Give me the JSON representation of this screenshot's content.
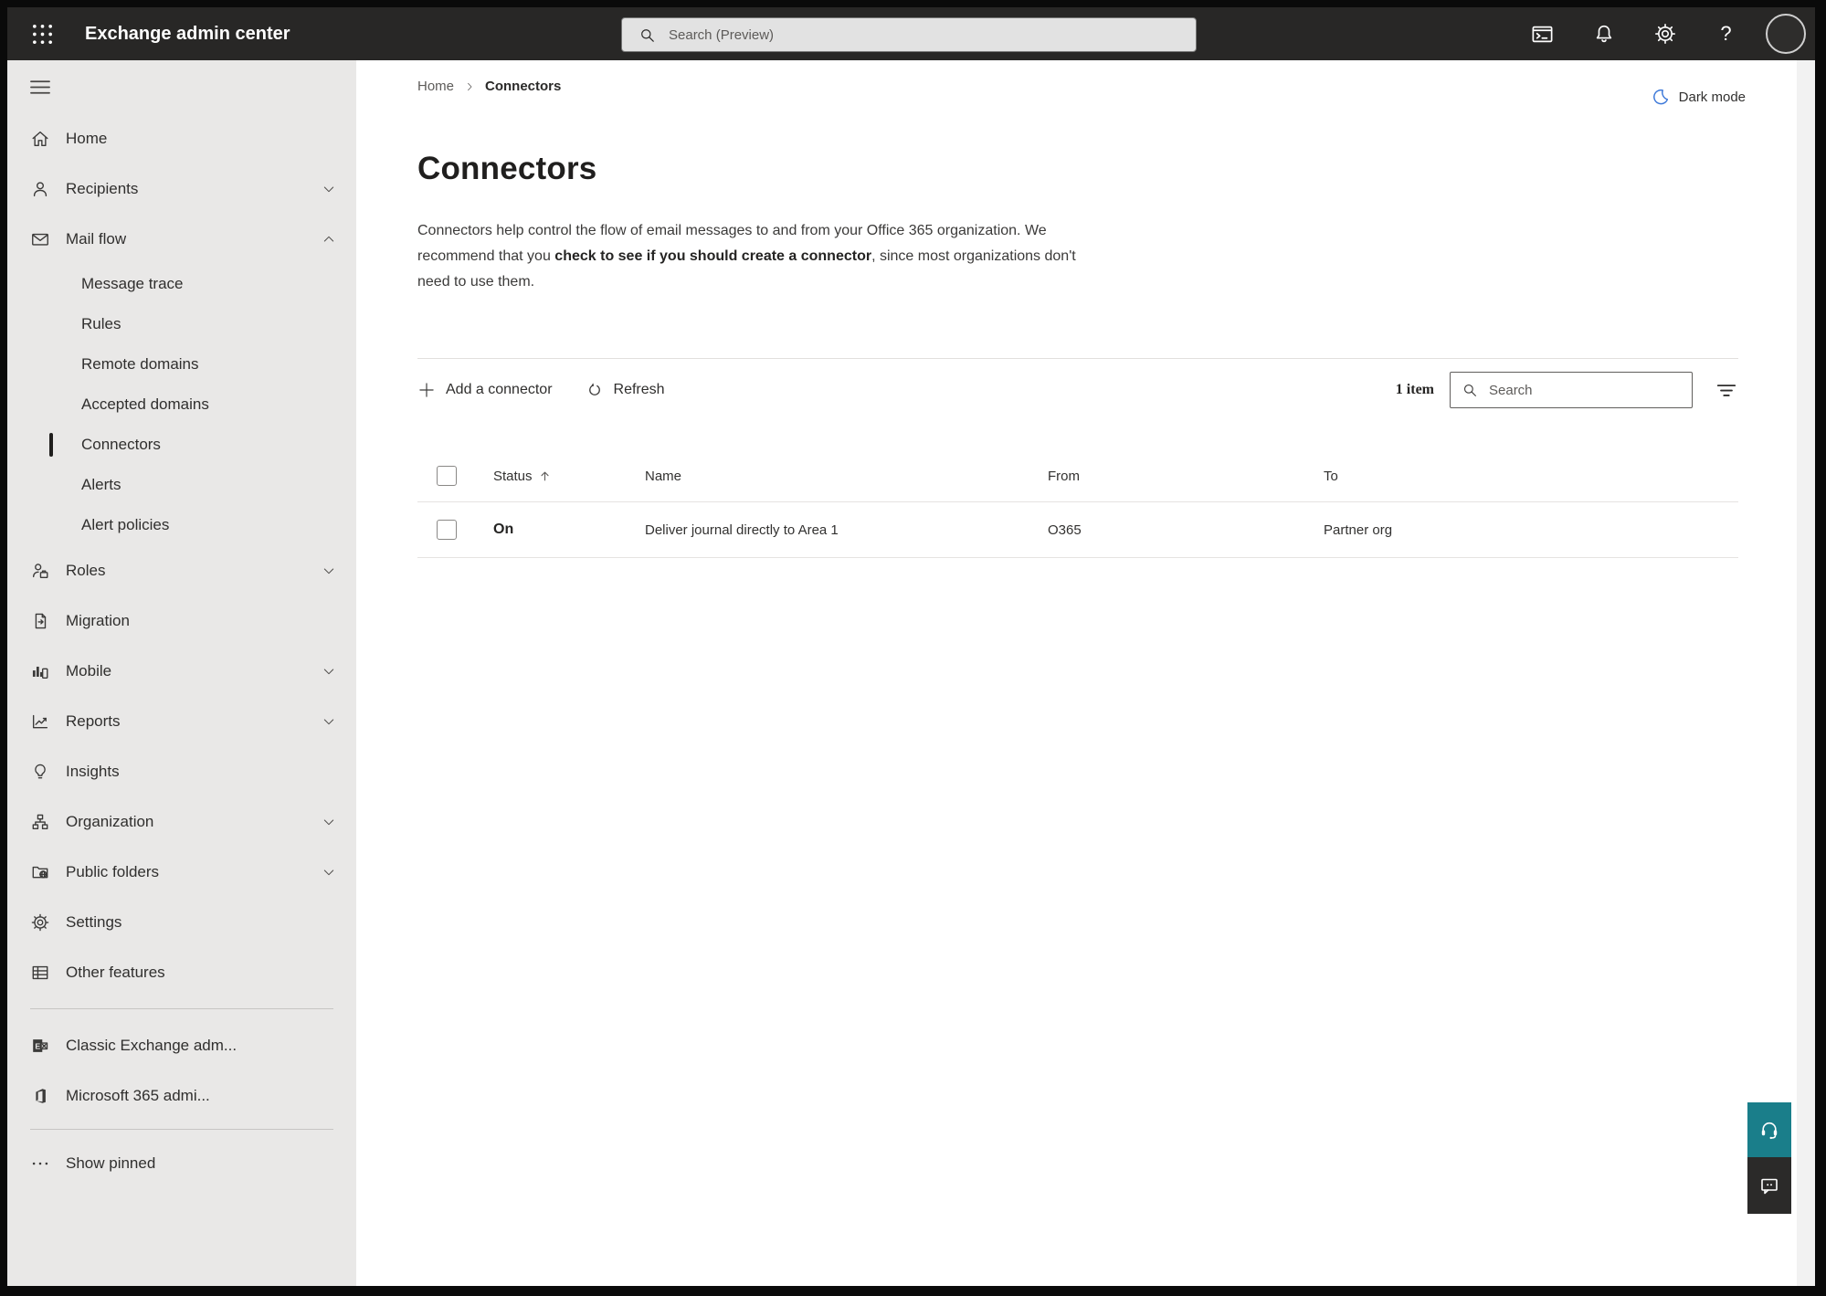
{
  "topbar": {
    "title": "Exchange admin center",
    "search_placeholder": "Search (Preview)",
    "icons": [
      "app-launcher-waffle-icon",
      "powershell-terminal-icon",
      "notifications-bell-icon",
      "settings-gear-icon",
      "help-icon",
      "avatar"
    ]
  },
  "sidebar": {
    "items": [
      {
        "label": "Home",
        "icon": "home-icon",
        "expandable": false
      },
      {
        "label": "Recipients",
        "icon": "recipients-person-icon",
        "expandable": true
      },
      {
        "label": "Mail flow",
        "icon": "mail-flow-envelope-icon",
        "expandable": true,
        "expanded": true
      },
      {
        "label": "Message trace",
        "parent": "Mail flow"
      },
      {
        "label": "Rules",
        "parent": "Mail flow"
      },
      {
        "label": "Remote domains",
        "parent": "Mail flow"
      },
      {
        "label": "Accepted domains",
        "parent": "Mail flow"
      },
      {
        "label": "Connectors",
        "parent": "Mail flow",
        "selected": true
      },
      {
        "label": "Alerts",
        "parent": "Mail flow"
      },
      {
        "label": "Alert policies",
        "parent": "Mail flow"
      },
      {
        "label": "Roles",
        "icon": "roles-person-badge-icon",
        "expandable": true
      },
      {
        "label": "Migration",
        "icon": "migration-document-icon",
        "expandable": false
      },
      {
        "label": "Mobile",
        "icon": "mobile-devices-icon",
        "expandable": true
      },
      {
        "label": "Reports",
        "icon": "reports-chart-icon",
        "expandable": true
      },
      {
        "label": "Insights",
        "icon": "insights-lightbulb-icon",
        "expandable": false
      },
      {
        "label": "Organization",
        "icon": "organization-chart-icon",
        "expandable": true
      },
      {
        "label": "Public folders",
        "icon": "public-folders-icon",
        "expandable": true
      },
      {
        "label": "Settings",
        "icon": "settings-gear-icon",
        "expandable": false
      },
      {
        "label": "Other features",
        "icon": "other-features-table-icon",
        "expandable": false
      },
      {
        "label": "Classic Exchange adm...",
        "icon": "classic-exchange-logo-icon"
      },
      {
        "label": "Microsoft 365 admi...",
        "icon": "microsoft-365-logo-icon"
      },
      {
        "label": "Show pinned",
        "icon": "ellipsis-icon"
      }
    ]
  },
  "breadcrumb": {
    "items": [
      "Home",
      "Connectors"
    ]
  },
  "dark_mode": {
    "label": "Dark mode",
    "icon": "moon-icon"
  },
  "page": {
    "title": "Connectors",
    "description": {
      "line1": "Connectors help control the flow of email messages to and from your Office 365 organization. We",
      "line2_pre": "recommend that you ",
      "line2_bold": "check to see if you should create a connector",
      "line2_post": ", since most organizations don't",
      "line3": "need to use them."
    }
  },
  "toolbar": {
    "add_connector_label": "Add a connector",
    "refresh_label": "Refresh",
    "item_count": "1 item",
    "search_placeholder": "Search"
  },
  "table": {
    "headers": {
      "status": "Status",
      "name": "Name",
      "from": "From",
      "to": "To"
    },
    "sorted_by": "Status ascending",
    "rows": [
      {
        "status": "On",
        "name": "Deliver journal directly to Area 1",
        "from": "O365",
        "to": "Partner org"
      }
    ]
  },
  "colors": {
    "topbar_bg": "#282726",
    "sidebar_bg": "#e9e8e7",
    "accent_teal": "#1a7e8a",
    "feedback_bg": "#2b2a29",
    "moon_blue": "#3d79d9"
  }
}
